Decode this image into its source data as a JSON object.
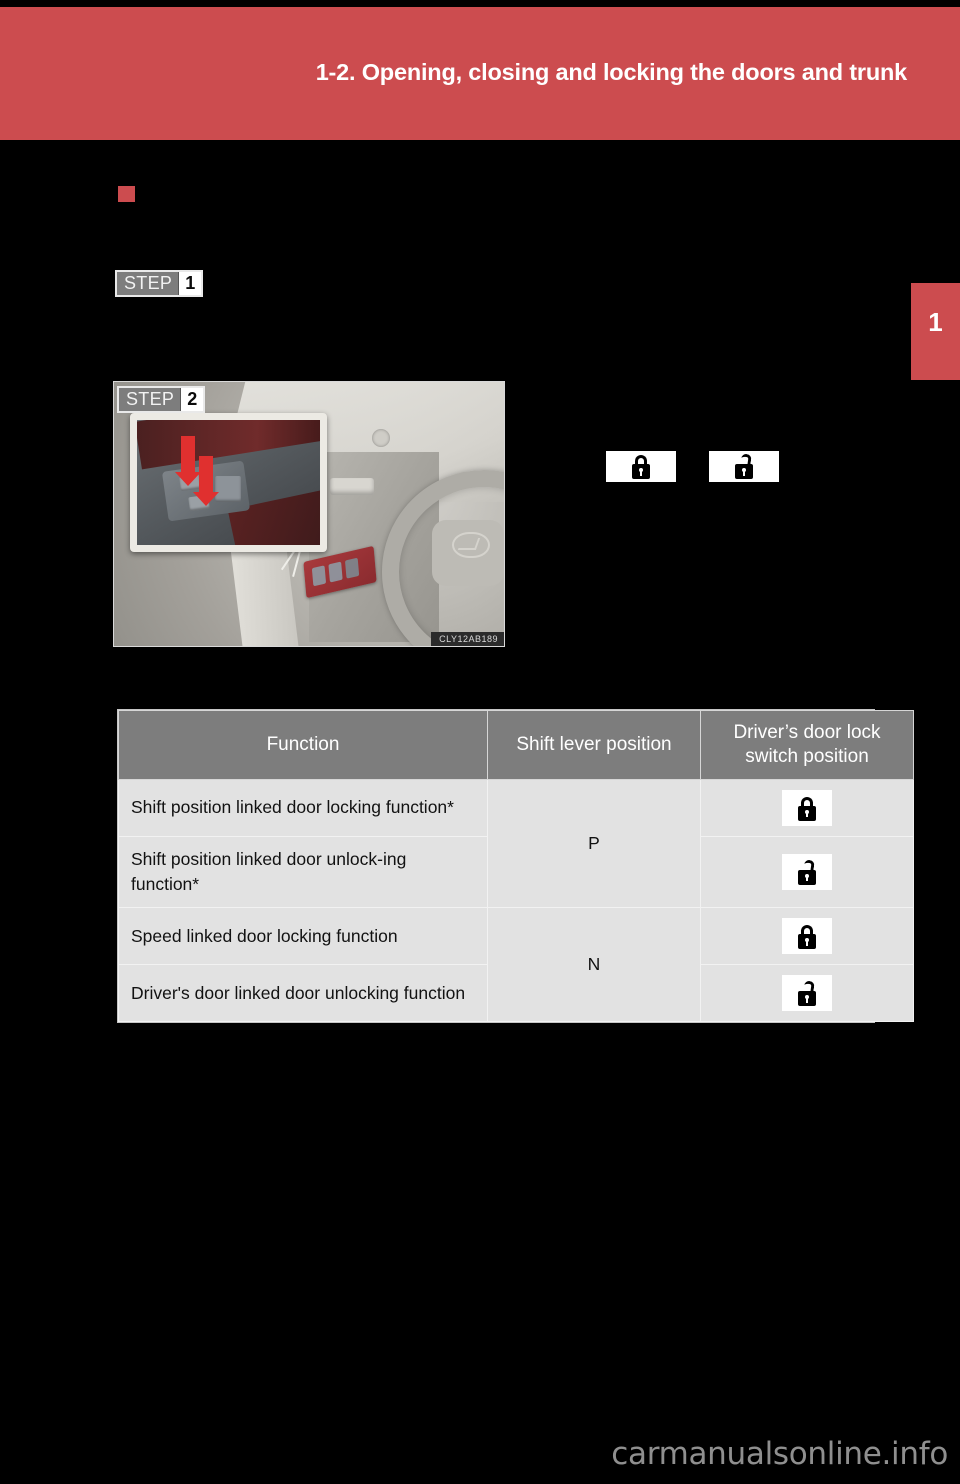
{
  "page": {
    "background_color": "#000000",
    "header": {
      "title": "1-2. Opening, closing and locking the doors and trunk",
      "band_color": "#cc4c4f",
      "text_color": "#ffffff"
    },
    "chapter_tab": {
      "number": "1",
      "color": "#cc4c4f"
    },
    "watermark": "carmanualsonline.info"
  },
  "section": {
    "bullet_color": "#cc4c4f"
  },
  "steps": [
    {
      "word": "STEP",
      "number": "1"
    },
    {
      "word": "STEP",
      "number": "2"
    }
  ],
  "figure": {
    "code": "CLY12AB189",
    "alt_name": "door-lock-switch-illustration"
  },
  "inline_icons": [
    {
      "name": "lock-icon",
      "state": "locked"
    },
    {
      "name": "unlock-icon",
      "state": "unlocked"
    }
  ],
  "table": {
    "headers": {
      "function": "Function",
      "shift": "Shift lever position",
      "switch": "Driver’s door lock switch position"
    },
    "rows": [
      {
        "function": "Shift position linked door locking function*",
        "shift": "P",
        "shift_rowspan": 2,
        "switch_state": "locked"
      },
      {
        "function": "Shift position linked door unlock-ing function*",
        "switch_state": "unlocked"
      },
      {
        "function": "Speed linked door locking function",
        "shift": "N",
        "shift_rowspan": 2,
        "switch_state": "locked"
      },
      {
        "function": "Driver's door linked door unlocking function",
        "switch_state": "unlocked"
      }
    ],
    "colors": {
      "header_bg": "#7d7d7d",
      "header_text": "#ffffff",
      "cell_bg": "#e2e2e2",
      "cell_text": "#121212",
      "grid": "#f2f2f2"
    }
  }
}
